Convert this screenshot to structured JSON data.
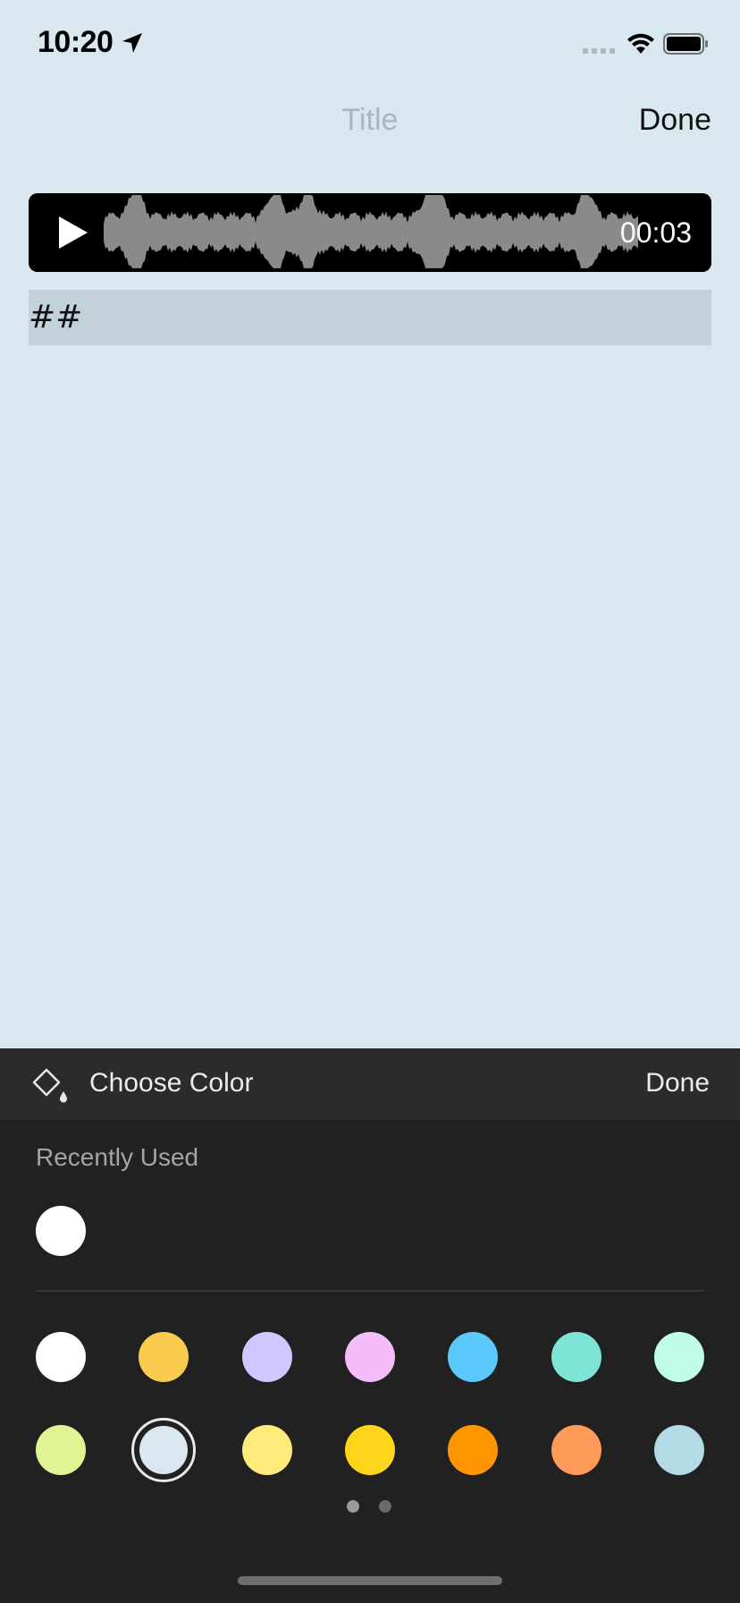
{
  "status_bar": {
    "time": "10:20",
    "icons": [
      "location-arrow-icon",
      "signal-icon",
      "wifi-icon",
      "battery-icon"
    ]
  },
  "nav": {
    "title_placeholder": "Title",
    "done_label": "Done"
  },
  "audio": {
    "duration": "00:03",
    "play_icon": "play-icon"
  },
  "note": {
    "text": "##"
  },
  "color_picker": {
    "title": "Choose Color",
    "done_label": "Done",
    "recent_label": "Recently Used",
    "recent_colors": [
      "#ffffff"
    ],
    "palette_row1": [
      "#ffffff",
      "#f9cb4f",
      "#cfc8ff",
      "#f4bdfa",
      "#5bc9fb",
      "#7ee4d6",
      "#c0fde7"
    ],
    "palette_row2": [
      "#dff594",
      "#d9e7ef",
      "#ffeb7b",
      "#ffd51c",
      "#ff9500",
      "#ff9a59",
      "#b2dbe6"
    ],
    "selected_color": "#d9e7ef",
    "page_dots": 2,
    "current_page": 1
  },
  "colors": {
    "background": "#d9e7ef",
    "sheet": "#212121",
    "sheet_header": "#2b2b2b",
    "text_highlight": "#c3d1d9"
  }
}
